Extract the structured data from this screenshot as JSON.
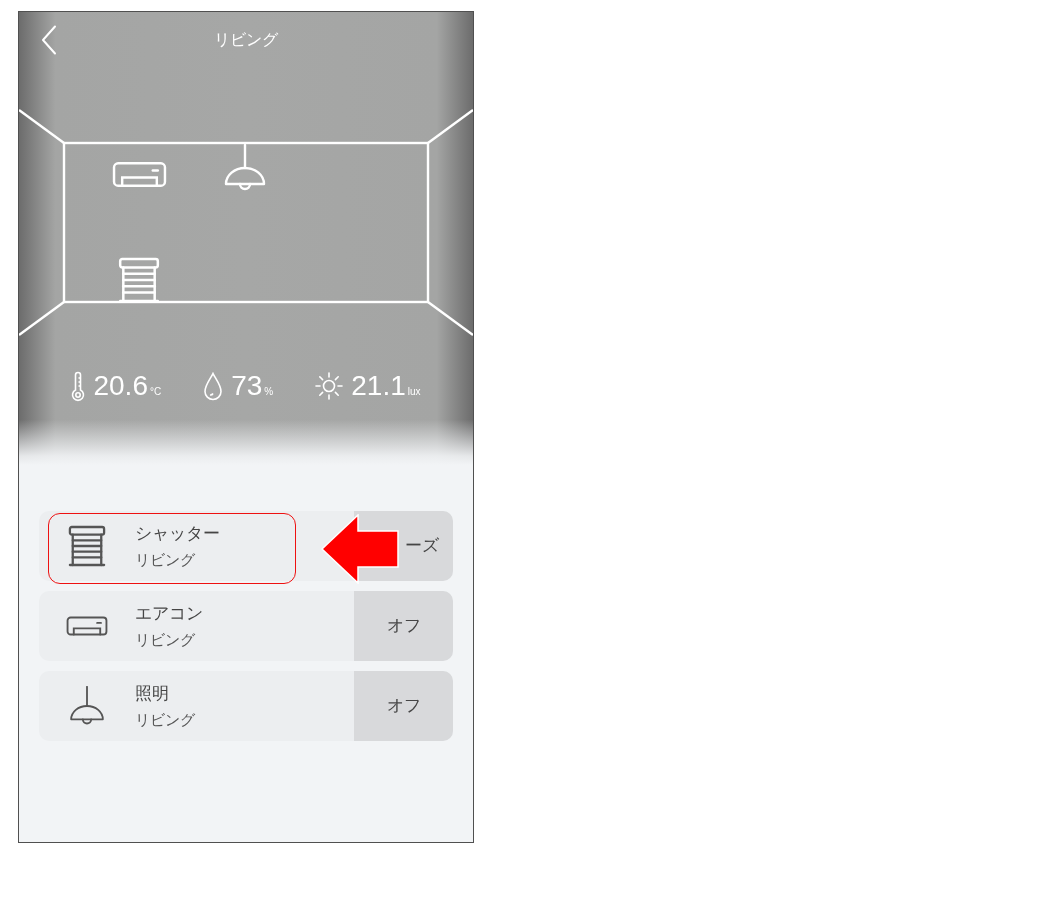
{
  "header": {
    "title": "リビング"
  },
  "sensors": [
    {
      "kind": "temperature",
      "value": "20.6",
      "unit": "°C"
    },
    {
      "kind": "humidity",
      "value": "73",
      "unit": "%"
    },
    {
      "kind": "illuminance",
      "value": "21.1",
      "unit": "lux"
    }
  ],
  "devices": [
    {
      "kind": "shutter",
      "name": "シャッター",
      "room": "リビング",
      "action": "ーズ",
      "highlighted": true
    },
    {
      "kind": "air_conditioner",
      "name": "エアコン",
      "room": "リビング",
      "action": "オフ",
      "highlighted": false
    },
    {
      "kind": "light",
      "name": "照明",
      "room": "リビング",
      "action": "オフ",
      "highlighted": false
    }
  ]
}
